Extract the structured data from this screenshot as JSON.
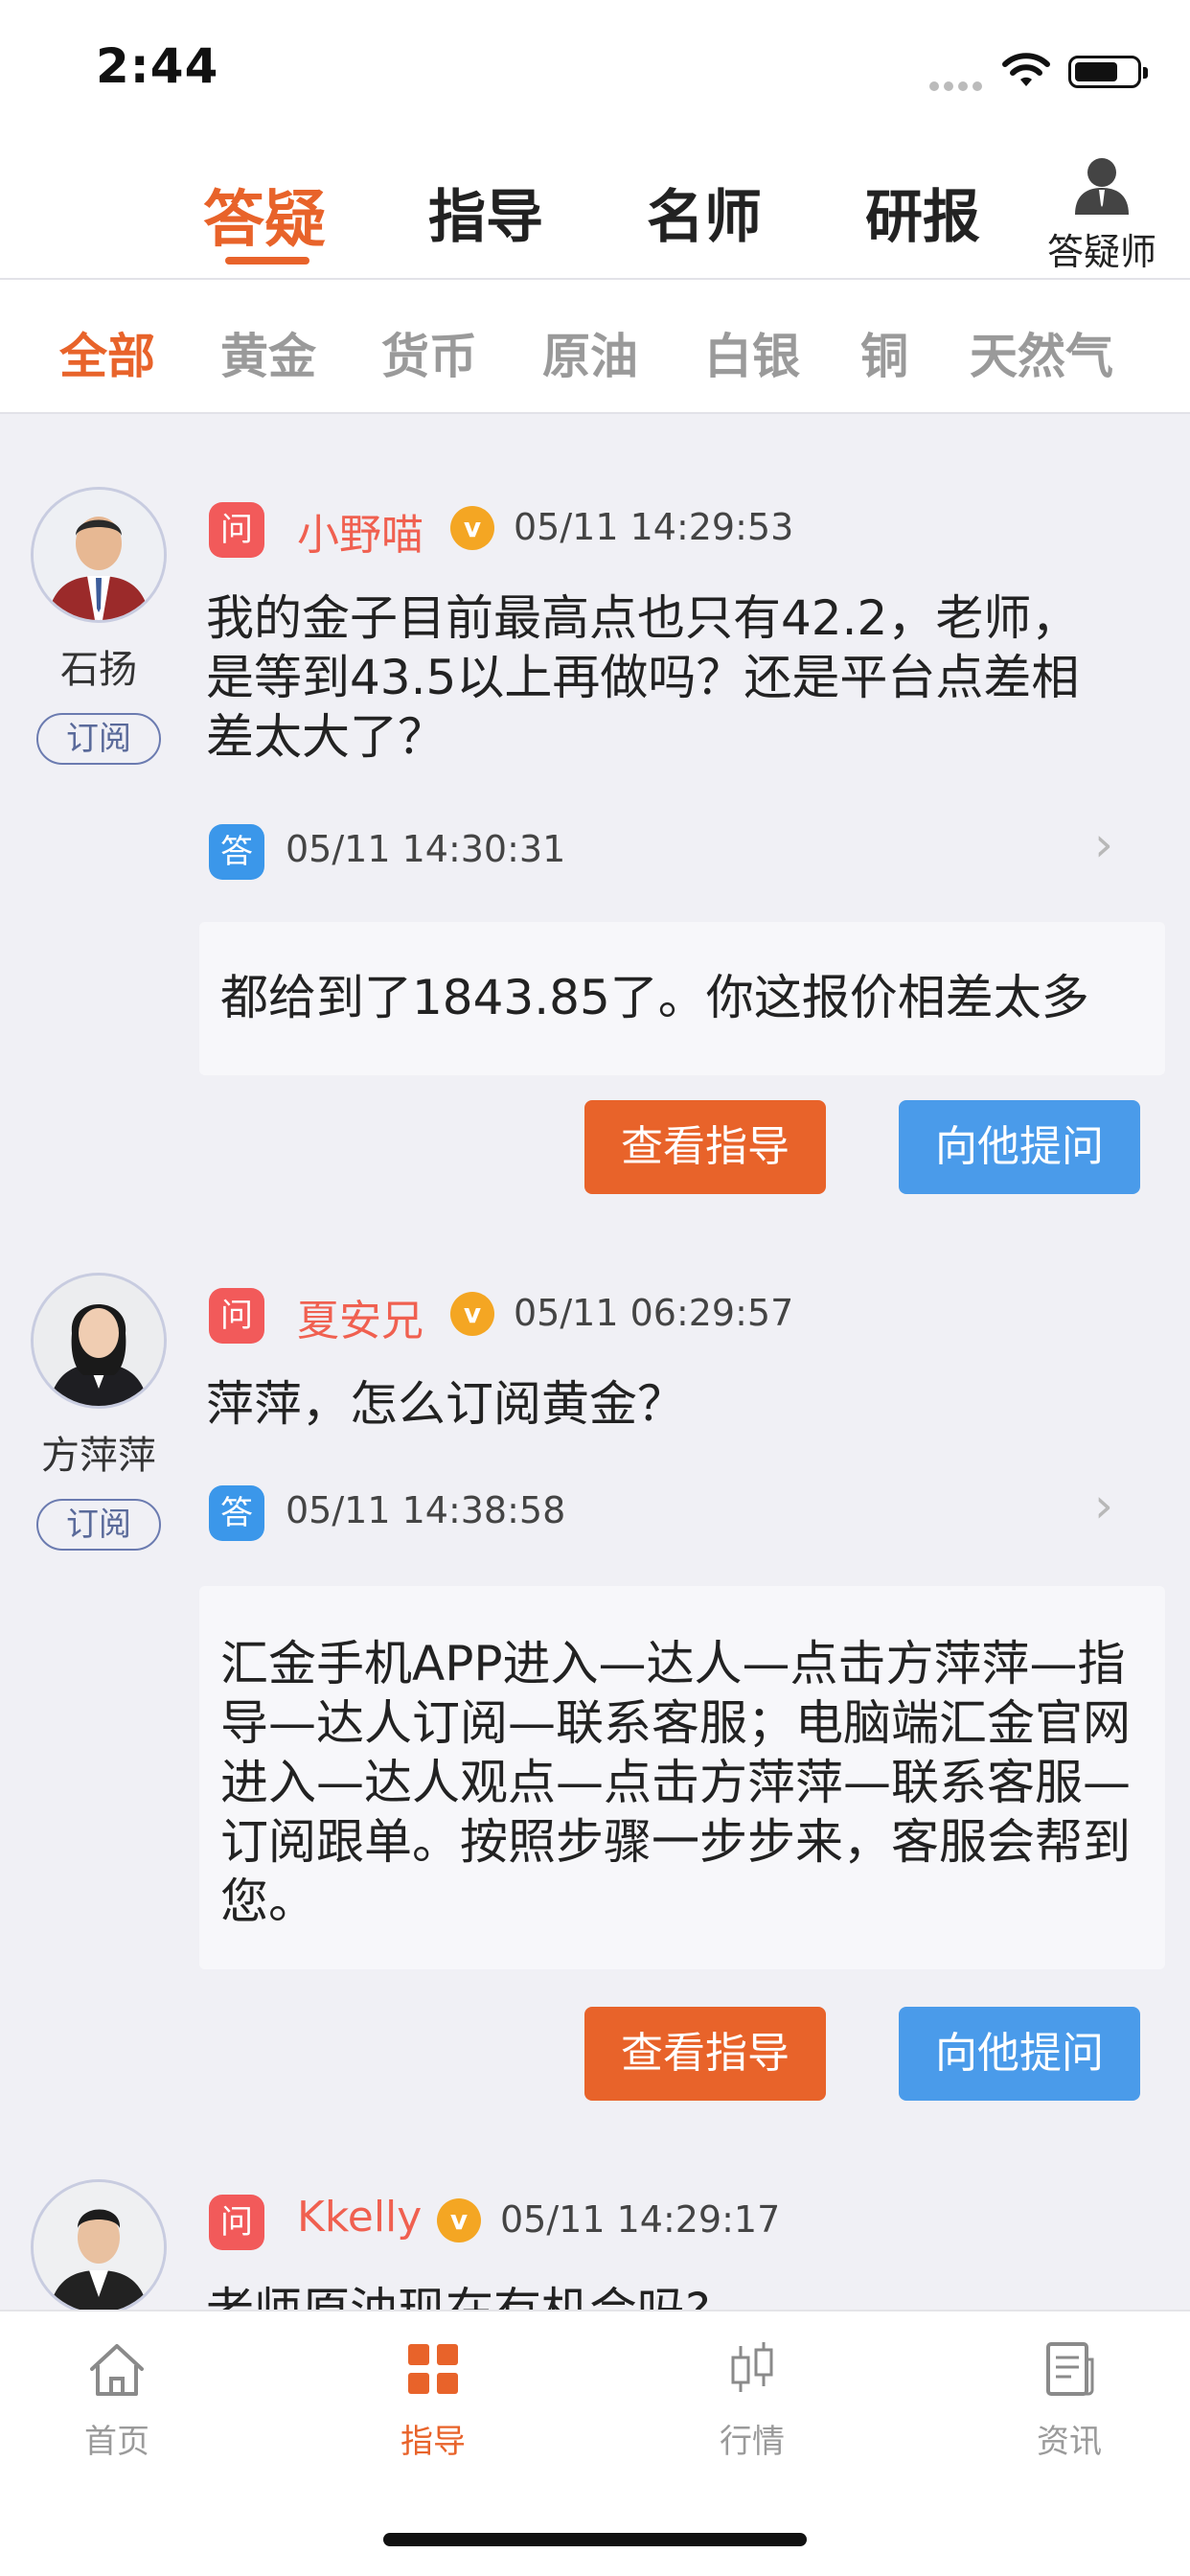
{
  "status": {
    "time": "2:44"
  },
  "top_tabs": [
    {
      "label": "答疑",
      "active": true
    },
    {
      "label": "指导",
      "active": false
    },
    {
      "label": "名师",
      "active": false
    },
    {
      "label": "研报",
      "active": false
    }
  ],
  "teacher_label": "答疑师",
  "categories": [
    {
      "label": "全部",
      "active": true
    },
    {
      "label": "黄金"
    },
    {
      "label": "货币"
    },
    {
      "label": "原油"
    },
    {
      "label": "白银"
    },
    {
      "label": "铜"
    },
    {
      "label": "天然气"
    }
  ],
  "posts": [
    {
      "teacher": "石扬",
      "subscribe": "订阅",
      "q_badge": "问",
      "asker": "小野喵",
      "vip": "v",
      "q_time": "05/11 14:29:53",
      "question": "我的金子目前最高点也只有42.2，老师，是等到43.5以上再做吗？还是平台点差相差太大了？",
      "a_badge": "答",
      "a_time": "05/11 14:30:31",
      "answer": "都给到了1843.85了。你这报价相差太多",
      "btn_view": "查看指导",
      "btn_ask": "向他提问"
    },
    {
      "teacher": "方萍萍",
      "subscribe": "订阅",
      "q_badge": "问",
      "asker": "夏安兄",
      "vip": "v",
      "q_time": "05/11 06:29:57",
      "question": "萍萍，怎么订阅黄金？",
      "a_badge": "答",
      "a_time": "05/11 14:38:58",
      "answer": "汇金手机APP进入—达人—点击方萍萍—指导—达人订阅—联系客服；电脑端汇金官网进入—达人观点—点击方萍萍—联系客服—订阅跟单。按照步骤一步步来，客服会帮到您。",
      "btn_view": "查看指导",
      "btn_ask": "向他提问"
    },
    {
      "q_badge": "问",
      "asker": "Kkelly",
      "vip": "v",
      "q_time": "05/11 14:29:17",
      "question": "老师原油现在有机会吗?"
    }
  ],
  "bottom_nav": [
    {
      "label": "首页",
      "icon": "home-icon"
    },
    {
      "label": "指导",
      "icon": "grid-icon",
      "active": true
    },
    {
      "label": "行情",
      "icon": "candlestick-icon"
    },
    {
      "label": "资讯",
      "icon": "news-icon"
    }
  ],
  "colors": {
    "accent": "#E8632A",
    "blue": "#4A9BEA",
    "question_red": "#F25A5A",
    "vip_gold": "#F4A623"
  }
}
